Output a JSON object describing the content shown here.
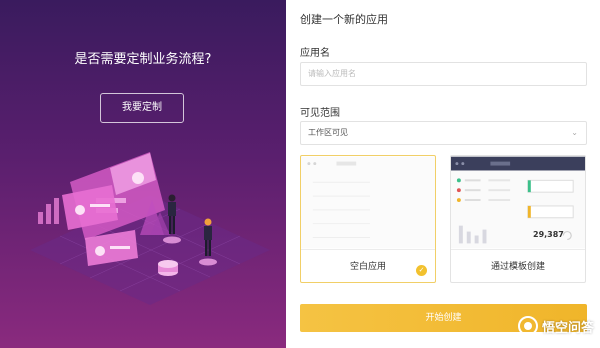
{
  "left": {
    "title": "是否需要定制业务流程?",
    "custom_button": "我要定制"
  },
  "form": {
    "title": "创建一个新的应用",
    "name_label": "应用名",
    "name_placeholder": "请输入应用名",
    "visibility_label": "可见范围",
    "visibility_value": "工作区可见",
    "options": [
      {
        "label": "空白应用",
        "selected": true
      },
      {
        "label": "通过模板创建",
        "selected": false,
        "preview_number": "29,387"
      }
    ],
    "start_button": "开始创建"
  },
  "watermark": {
    "text": "悟空问答"
  },
  "colors": {
    "accent": "#f2c12e",
    "left_bg_top": "#3a1b5e",
    "left_bg_bottom": "#8a2a7e",
    "template_header": "#3b3f5c"
  }
}
